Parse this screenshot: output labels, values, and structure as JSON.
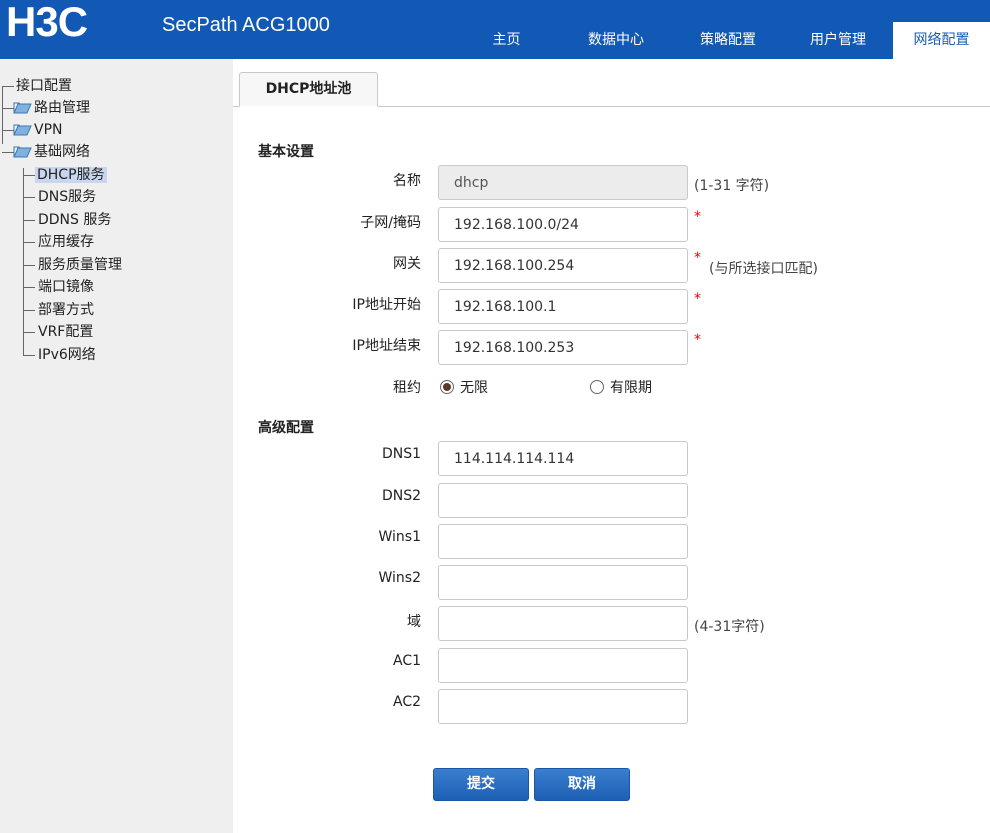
{
  "header": {
    "logo_text": "H3C",
    "product": "SecPath ACG1000",
    "nav": [
      "主页",
      "数据中心",
      "策略配置",
      "用户管理",
      "网络配置"
    ],
    "active_nav": "网络配置",
    "brand_color": "#1258b5"
  },
  "sidebar": {
    "top_items": [
      "接口配置",
      "路由管理",
      "VPN",
      "基础网络"
    ],
    "children": [
      "DHCP服务",
      "DNS服务",
      "DDNS 服务",
      "应用缓存",
      "服务质量管理",
      "端口镜像",
      "部署方式",
      "VRF配置",
      "IPv6网络"
    ],
    "selected": "DHCP服务"
  },
  "tab": {
    "label": "DHCP地址池"
  },
  "basic": {
    "title": "基本设置",
    "name_label": "名称",
    "name_value": "dhcp",
    "name_hint": "(1-31 字符)",
    "subnet_label": "子网/掩码",
    "subnet_value": "192.168.100.0/24",
    "gateway_label": "网关",
    "gateway_value": "192.168.100.254",
    "gateway_hint": "(与所选接口匹配)",
    "ip_start_label": "IP地址开始",
    "ip_start_value": "192.168.100.1",
    "ip_end_label": "IP地址结束",
    "ip_end_value": "192.168.100.253",
    "lease_label": "租约",
    "lease_unlimited": "无限",
    "lease_limited": "有限期",
    "required_mark": "*"
  },
  "advanced": {
    "title": "高级配置",
    "dns1_label": "DNS1",
    "dns1_value": "114.114.114.114",
    "dns2_label": "DNS2",
    "dns2_value": "",
    "wins1_label": "Wins1",
    "wins1_value": "",
    "wins2_label": "Wins2",
    "wins2_value": "",
    "domain_label": "域",
    "domain_value": "",
    "domain_hint": "(4-31字符)",
    "ac1_label": "AC1",
    "ac1_value": "",
    "ac2_label": "AC2",
    "ac2_value": ""
  },
  "actions": {
    "submit": "提交",
    "cancel": "取消"
  }
}
